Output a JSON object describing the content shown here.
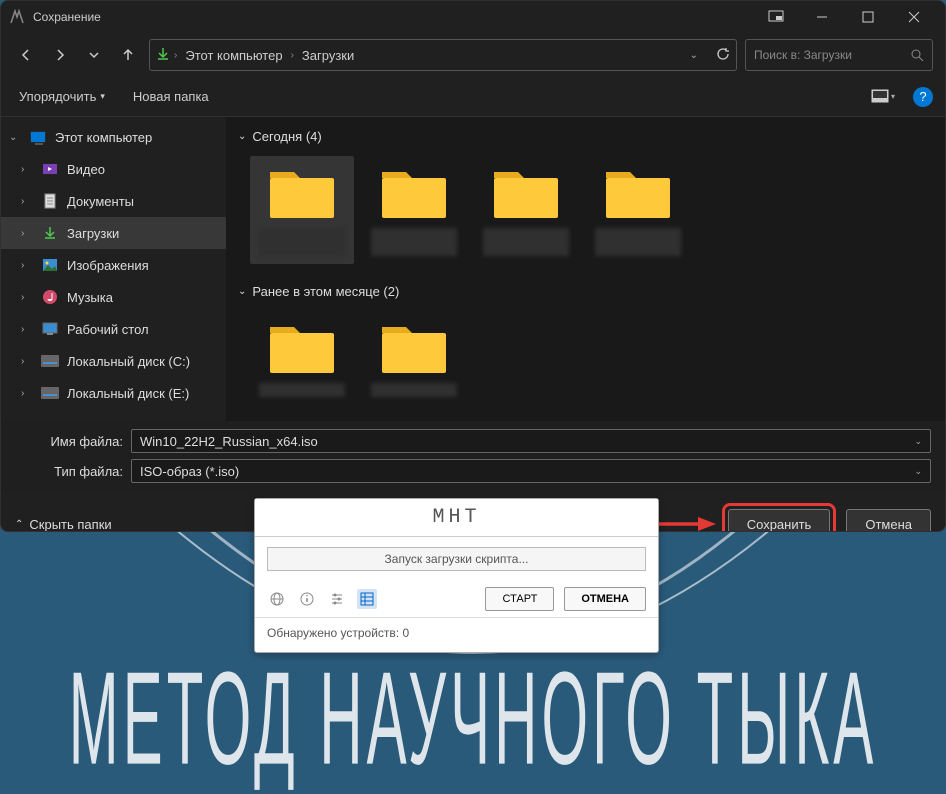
{
  "dialog": {
    "title": "Сохранение",
    "breadcrumb": {
      "root": "Этот компьютер",
      "current": "Загрузки"
    },
    "search_placeholder": "Поиск в: Загрузки",
    "toolbar": {
      "organize": "Упорядочить",
      "new_folder": "Новая папка"
    },
    "sidebar": {
      "items": [
        {
          "label": "Этот компьютер",
          "icon": "monitor",
          "expanded": true,
          "level": 0
        },
        {
          "label": "Видео",
          "icon": "video",
          "level": 1
        },
        {
          "label": "Документы",
          "icon": "document",
          "level": 1
        },
        {
          "label": "Загрузки",
          "icon": "download",
          "level": 1,
          "selected": true
        },
        {
          "label": "Изображения",
          "icon": "images",
          "level": 1
        },
        {
          "label": "Музыка",
          "icon": "music",
          "level": 1
        },
        {
          "label": "Рабочий стол",
          "icon": "desktop",
          "level": 1
        },
        {
          "label": "Локальный диск (C:)",
          "icon": "disk",
          "level": 1
        },
        {
          "label": "Локальный диск (E:)",
          "icon": "disk",
          "level": 1
        }
      ]
    },
    "groups": [
      {
        "label": "Сегодня (4)",
        "count": 4
      },
      {
        "label": "Ранее в этом месяце (2)",
        "count": 2
      }
    ],
    "filename_label": "Имя файла:",
    "filename_value": "Win10_22H2_Russian_x64.iso",
    "filetype_label": "Тип файла:",
    "filetype_value": "ISO-образ (*.iso)",
    "hide_folders": "Скрыть папки",
    "save_button": "Сохранить",
    "cancel_button": "Отмена"
  },
  "secondary": {
    "logo": "MHT",
    "progress_text": "Запуск загрузки скрипта...",
    "start_button": "СТАРТ",
    "cancel_button": "ОТМЕНА",
    "status_prefix": "Обнаружено устройств: ",
    "devices_count": "0"
  },
  "background": {
    "text": "МЕТОД НАУЧНОГО ТЫКА"
  },
  "help_symbol": "?"
}
